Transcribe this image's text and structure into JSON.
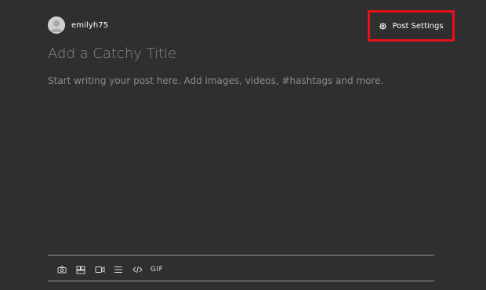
{
  "author": {
    "username": "emilyh75",
    "avatar_icon": "user-avatar-icon"
  },
  "header": {
    "settings_label": "Post Settings",
    "settings_icon": "gear-icon",
    "highlight_color": "#e8101a"
  },
  "editor": {
    "title_placeholder": "Add a Catchy Title",
    "body_placeholder": "Start writing your post here. Add images, videos, #hashtags and more."
  },
  "toolbar": {
    "items": [
      {
        "icon": "camera-icon"
      },
      {
        "icon": "gallery-icon"
      },
      {
        "icon": "video-icon"
      },
      {
        "icon": "divider-icon"
      },
      {
        "icon": "code-icon"
      },
      {
        "label": "GIF"
      }
    ]
  },
  "colors": {
    "background": "#2f2f2f",
    "placeholder_text": "#8b8b8b",
    "text": "#ffffff"
  }
}
